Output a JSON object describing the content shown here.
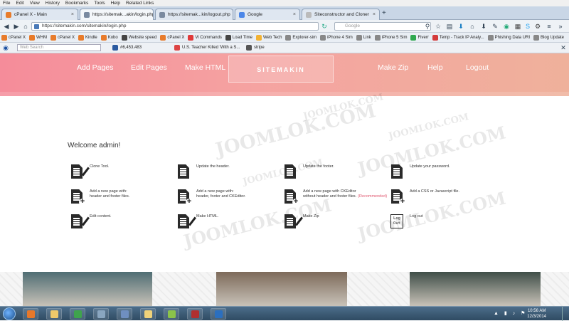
{
  "menu": [
    "File",
    "Edit",
    "View",
    "History",
    "Bookmarks",
    "Tools",
    "Help",
    "Related Links"
  ],
  "tabs": [
    {
      "label": "cPanel X - Main",
      "color": "#e87b2a"
    },
    {
      "label": "https://sitemak...akin/login.php",
      "color": "#7a8aa0",
      "active": true
    },
    {
      "label": "https://sitemak...kin/logout.php",
      "color": "#7a8aa0"
    },
    {
      "label": "Google",
      "color": "#4a86e8"
    },
    {
      "label": "Siteconstructor and Cloner",
      "color": "#bbbbbb"
    }
  ],
  "new_tab": "+",
  "url": "https://sitemakin.com/sitemakin/login.php",
  "search_placeholder": "Google",
  "bookmarks": [
    {
      "label": "cPanel X",
      "color": "#e87b2a"
    },
    {
      "label": "WHM",
      "color": "#e87b2a"
    },
    {
      "label": "cPanel X",
      "color": "#e87b2a"
    },
    {
      "label": "Kindle",
      "color": "#e87b2a"
    },
    {
      "label": "Kobo",
      "color": "#e87b2a"
    },
    {
      "label": "Website speed",
      "color": "#444444"
    },
    {
      "label": "cPanel X",
      "color": "#e87b2a"
    },
    {
      "label": "Vi Commands",
      "color": "#e03a3a"
    },
    {
      "label": "Load Time",
      "color": "#444444"
    },
    {
      "label": "Web Tech",
      "color": "#f2b233"
    },
    {
      "label": "Explorer-sim",
      "color": "#888888"
    },
    {
      "label": "iPhone 4 Sim",
      "color": "#888888"
    },
    {
      "label": "Link",
      "color": "#888888"
    },
    {
      "label": "iPhone 5 Sim",
      "color": "#888888"
    },
    {
      "label": "Fiverr",
      "color": "#2fa84f"
    },
    {
      "label": "Temp - Track IP Analy...",
      "color": "#d43b3b"
    },
    {
      "label": "Phishing Data URI",
      "color": "#888888"
    },
    {
      "label": "Blog Update",
      "color": "#888888"
    }
  ],
  "toolbar2": {
    "web_search": "Web Search",
    "counter": "#6,453,483",
    "news": "U.S. Teacher Killed 'With a S...",
    "stripe": "stripe"
  },
  "site": {
    "nav": [
      "Add Pages",
      "Edit Pages",
      "Make HTML",
      "Make Zip",
      "Help",
      "Logout"
    ],
    "logo": "SITEMAKIN",
    "welcome": "Welcome admin!",
    "actions": [
      {
        "icon": "doc-pen",
        "text": "Clone Tool."
      },
      {
        "icon": "doc",
        "text": "Update the header."
      },
      {
        "icon": "doc",
        "text": "Update the footer."
      },
      {
        "icon": "doc",
        "text": "Update your password."
      },
      {
        "icon": "doc-plus",
        "text": "Add a new page with:",
        "text2": "header and footer files."
      },
      {
        "icon": "doc-plus",
        "text": "Add a new page with:",
        "text2": "header, footer and CKEditor."
      },
      {
        "icon": "doc-plus",
        "text": "Add a new page with CKEditor",
        "text2": "without header and footer files.",
        "rec": "(Recommended)"
      },
      {
        "icon": "doc-plus",
        "text": "Add a CSS or Javascript file."
      },
      {
        "icon": "doc-pen",
        "text": "Edit content."
      },
      {
        "icon": "doc-pen",
        "text": "Make HTML."
      },
      {
        "icon": "doc-pen",
        "text": "Make Zip"
      },
      {
        "icon": "logout",
        "text": "Log out",
        "icon_text": "Log Out"
      }
    ],
    "watermark": "JOOMLOK.COM"
  },
  "photos": [
    {
      "color": "#4f6d73"
    },
    {
      "color": "#7d6a5a"
    },
    {
      "color": "#3f4e48"
    }
  ],
  "taskbar": {
    "apps": [
      {
        "name": "firefox",
        "color": "#e8782a"
      },
      {
        "name": "explorer",
        "color": "#f0c96a"
      },
      {
        "name": "chrome",
        "color": "#3fa34d"
      },
      {
        "name": "network",
        "color": "#8aa6c0"
      },
      {
        "name": "virtualbox",
        "color": "#6f8fc0"
      },
      {
        "name": "folder",
        "color": "#f0d27a"
      },
      {
        "name": "notepad",
        "color": "#8bc34a"
      },
      {
        "name": "pdf",
        "color": "#b03030"
      },
      {
        "name": "photoshop",
        "color": "#2b6fbf"
      }
    ],
    "time": "10:56 AM",
    "date": "12/3/2014"
  }
}
